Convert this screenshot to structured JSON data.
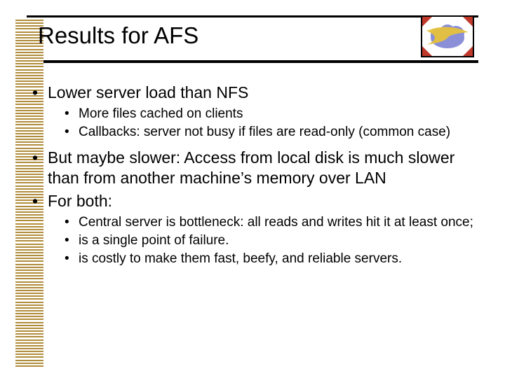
{
  "title": "Results for AFS",
  "bullets": [
    {
      "text": "Lower server load than NFS",
      "sub": [
        "More files cached on clients",
        "Callbacks:  server not busy if files are read-only (common case)"
      ]
    },
    {
      "text": "But maybe slower:  Access from local disk is much slower than from another machine’s memory over LAN",
      "sub": []
    },
    {
      "text": "For both:",
      "sub": [
        "Central server is bottleneck:  all reads and writes hit it at least once;",
        "is a single point of failure.",
        "is costly to make them fast, beefy, and reliable servers."
      ]
    }
  ],
  "logo": {
    "name": "cloud-swoosh-icon"
  },
  "colors": {
    "binding": "#b08c3b",
    "cloud": "#8a8fd8",
    "swoosh": "#e6c23d",
    "corner": "#c0392b"
  }
}
